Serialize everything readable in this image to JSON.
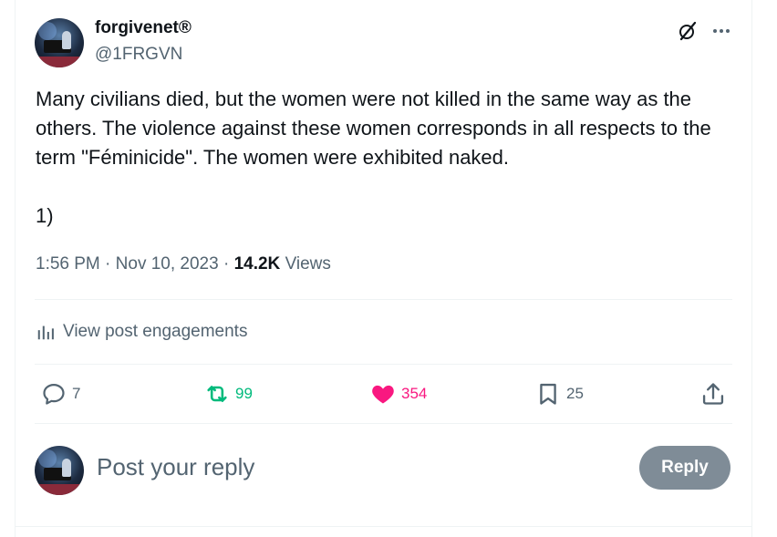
{
  "author": {
    "display_name": "forgivenet®",
    "handle": "@1FRGVN"
  },
  "post": {
    "paragraph_1": "Many civilians died, but the women were not killed in the same way as the others. The violence against these women corresponds in all respects to the term \"Féminicide\". The women were exhibited naked.",
    "paragraph_2": "1)",
    "time": "1:56 PM",
    "separator": "·",
    "date": "Nov 10, 2023",
    "views_count": "14.2K",
    "views_label": "Views"
  },
  "engagements": {
    "label": "View post engagements"
  },
  "actions": {
    "replies": "7",
    "reposts": "99",
    "likes": "354",
    "bookmarks": "25"
  },
  "reply_box": {
    "placeholder": "Post your reply",
    "button_label": "Reply"
  },
  "icons": {
    "header": [
      "grok-icon",
      "more-icon"
    ],
    "engagements": "analytics-icon",
    "actions": [
      "reply-icon",
      "repost-icon",
      "like-icon",
      "bookmark-icon",
      "share-icon"
    ]
  },
  "colors": {
    "text_primary": "#0f1419",
    "text_secondary": "#536471",
    "repost_green": "#00ba7c",
    "like_pink": "#f91880",
    "reply_button_bg": "#7f8c97",
    "divider": "#eff3f4"
  }
}
